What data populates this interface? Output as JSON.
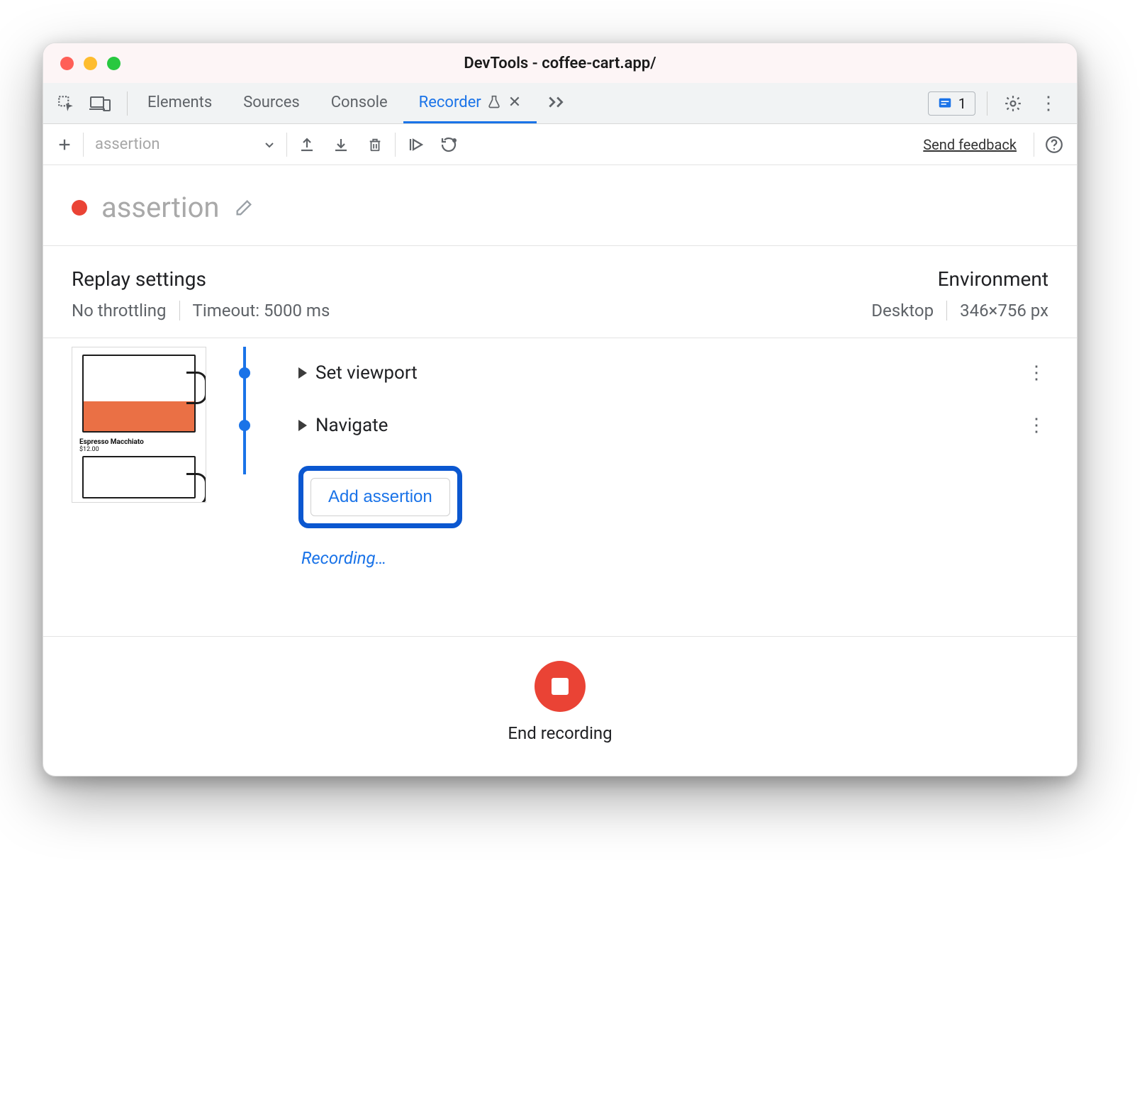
{
  "window": {
    "title": "DevTools - coffee-cart.app/"
  },
  "tabs": {
    "items": [
      "Elements",
      "Sources",
      "Console",
      "Recorder"
    ],
    "active_index": 3
  },
  "issues_badge": {
    "count": "1"
  },
  "toolbar": {
    "recording_select": "assertion",
    "send_feedback": "Send feedback"
  },
  "recording": {
    "title": "assertion"
  },
  "replay_settings": {
    "heading": "Replay settings",
    "throttling": "No throttling",
    "timeout": "Timeout: 5000 ms"
  },
  "environment": {
    "heading": "Environment",
    "device": "Desktop",
    "viewport": "346×756 px"
  },
  "preview": {
    "label": "Espresso Macchiato",
    "price": "$12.00"
  },
  "steps": [
    {
      "label": "Set viewport"
    },
    {
      "label": "Navigate"
    }
  ],
  "actions": {
    "add_assertion": "Add assertion",
    "recording_status": "Recording…",
    "end_recording": "End recording"
  }
}
